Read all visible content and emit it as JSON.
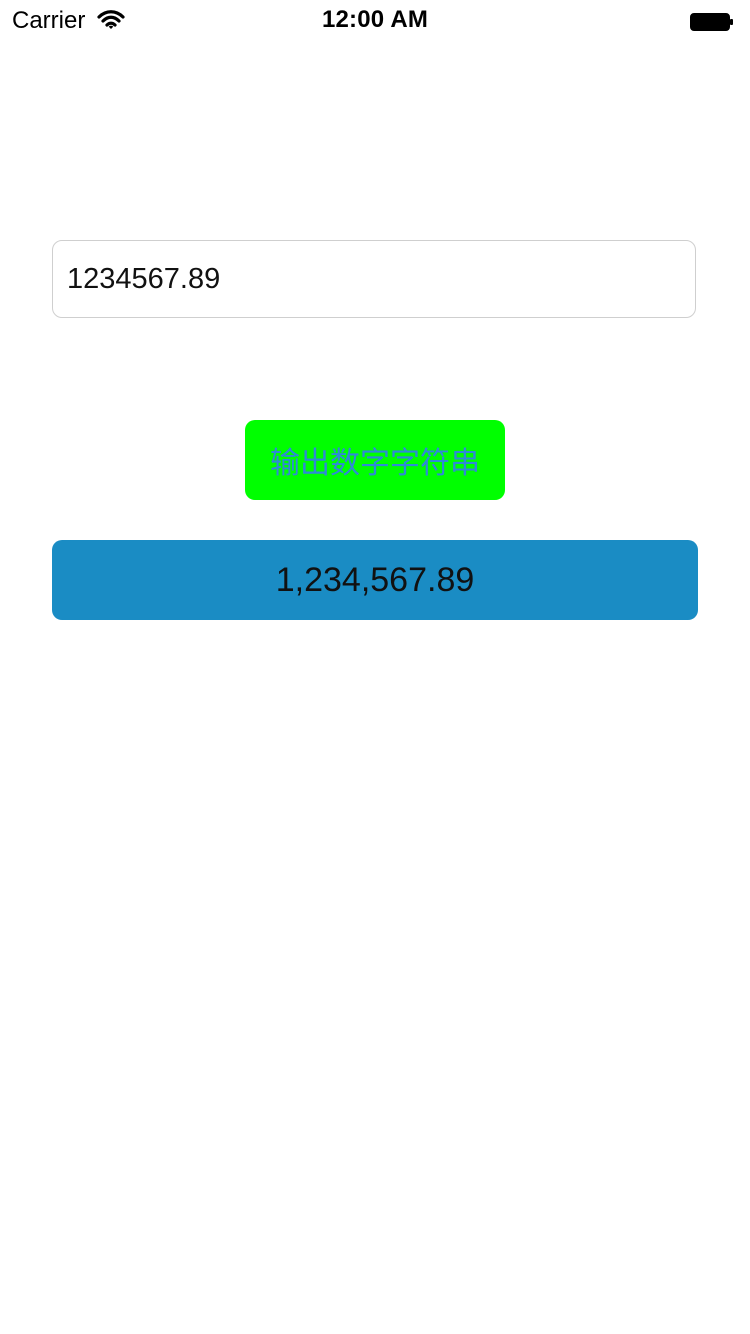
{
  "status_bar": {
    "carrier": "Carrier",
    "time": "12:00 AM",
    "icons": {
      "wifi": "wifi-icon",
      "battery": "battery-icon"
    }
  },
  "form": {
    "number_input_value": "1234567.89",
    "button_label": "输出数字字符串",
    "result_text": "1,234,567.89"
  },
  "colors": {
    "button_background": "#00ff00",
    "button_text": "#2f89d7",
    "result_background": "#1a8cc4"
  }
}
